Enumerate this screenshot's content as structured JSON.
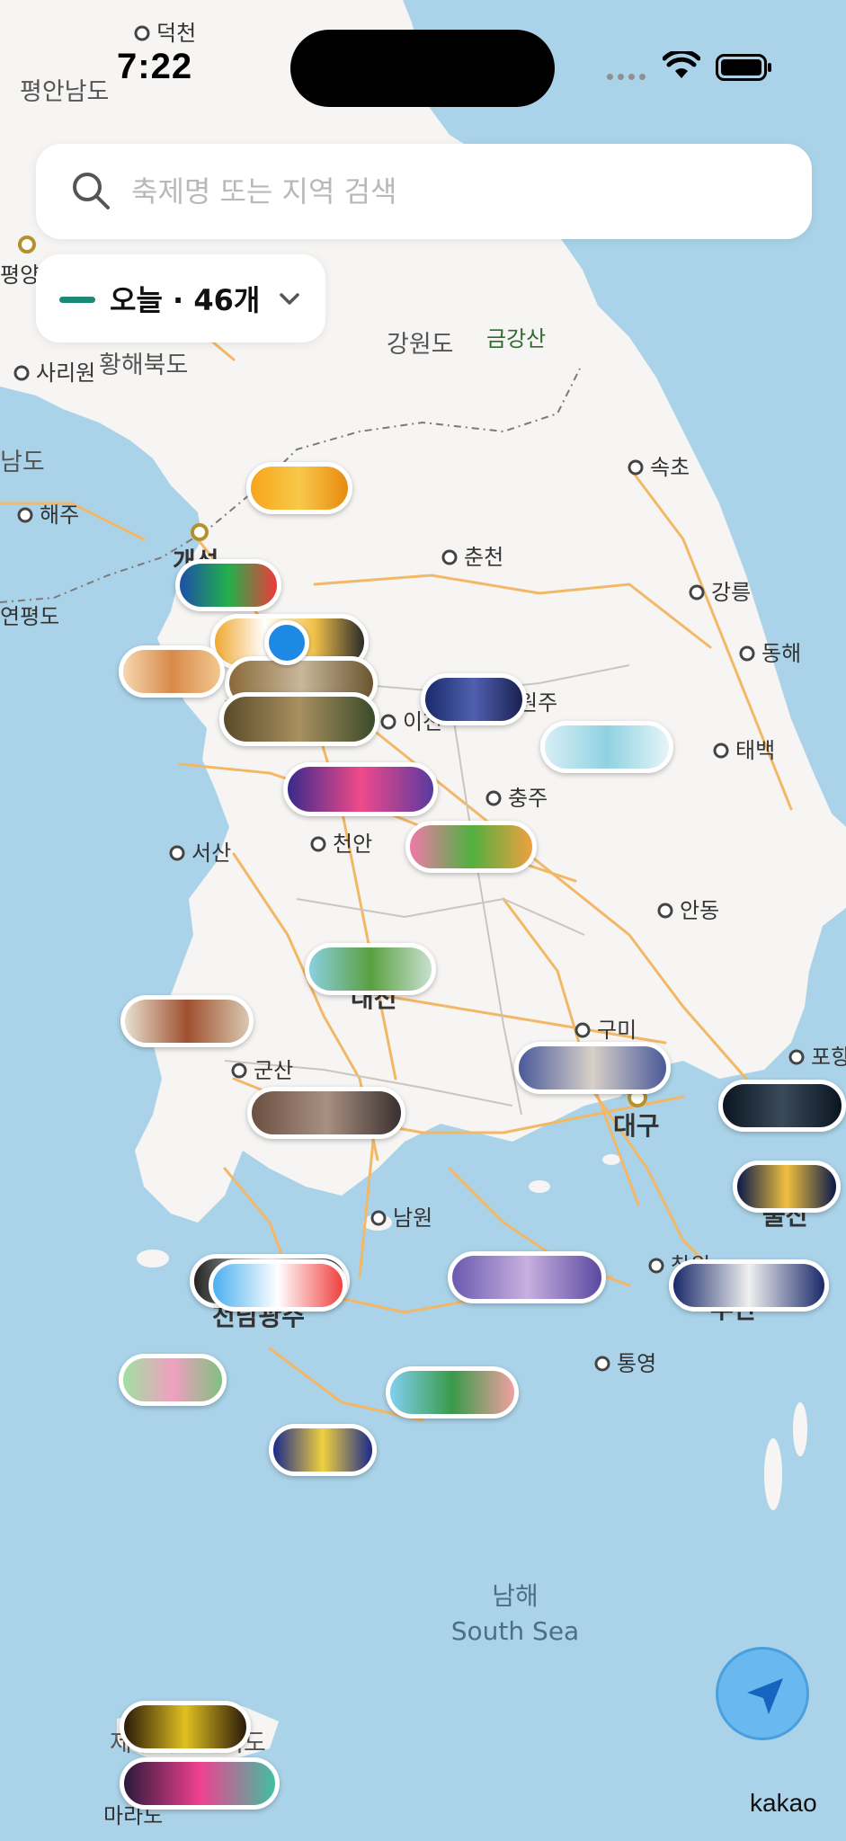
{
  "status_bar": {
    "time": "7:22"
  },
  "search": {
    "placeholder": "축제명 또는 지역 검색"
  },
  "filter": {
    "label": "오늘 · 46개",
    "accent_color": "#1a8a76",
    "icon": "chevron-down-icon"
  },
  "map": {
    "attribution": "kakao",
    "regions": [
      {
        "name": "평안남도"
      },
      {
        "name": "황해북도"
      },
      {
        "name": "강원도"
      },
      {
        "name": "금강산"
      },
      {
        "name": "남도"
      }
    ],
    "cities": [
      {
        "name": "덕천"
      },
      {
        "name": "평양"
      },
      {
        "name": "사리원"
      },
      {
        "name": "해주"
      },
      {
        "name": "개성"
      },
      {
        "name": "연평도"
      },
      {
        "name": "속초"
      },
      {
        "name": "춘천"
      },
      {
        "name": "강릉"
      },
      {
        "name": "동해"
      },
      {
        "name": "이천"
      },
      {
        "name": "원주"
      },
      {
        "name": "태백"
      },
      {
        "name": "충주"
      },
      {
        "name": "서산"
      },
      {
        "name": "천안"
      },
      {
        "name": "안동"
      },
      {
        "name": "대전"
      },
      {
        "name": "구미"
      },
      {
        "name": "포항"
      },
      {
        "name": "군산"
      },
      {
        "name": "대구"
      },
      {
        "name": "울산"
      },
      {
        "name": "남원"
      },
      {
        "name": "창원"
      },
      {
        "name": "부산"
      },
      {
        "name": "전남광주"
      },
      {
        "name": "통영"
      },
      {
        "name": "마라도"
      },
      {
        "name": "제주특별자치도"
      }
    ],
    "sea": {
      "korean": "남해",
      "english": "South Sea"
    }
  },
  "colors": {
    "sea": "#aad3e9",
    "land": "#f6f5f3",
    "road": "#f2b866",
    "my_location": "#1e88e5"
  }
}
